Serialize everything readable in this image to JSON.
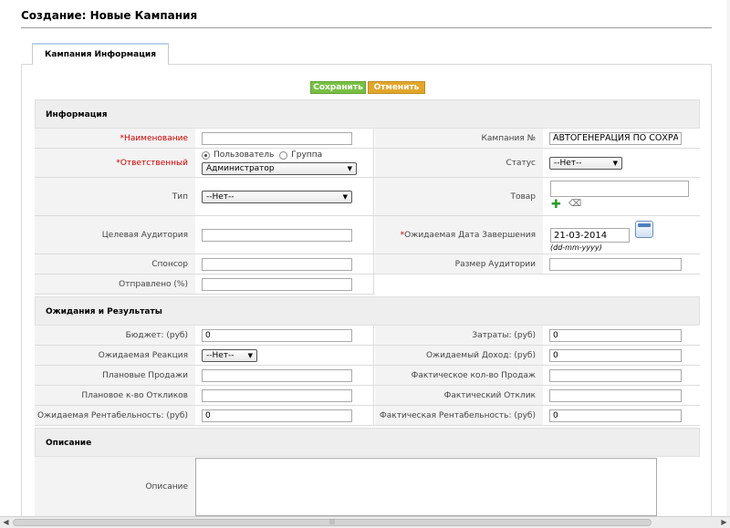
{
  "page": {
    "title": "Создание: Новые Кампания"
  },
  "tabs": [
    {
      "label": "Кампания Информация",
      "active": true
    }
  ],
  "toolbar": {
    "save_label": "Сохранить",
    "cancel_label": "Отменить"
  },
  "sections": {
    "info": "Информация",
    "expectations": "Ожидания и Результаты",
    "description": "Описание"
  },
  "info": {
    "name_label": "*Наименование",
    "name_value": "",
    "campaign_no_label": "Кампания №",
    "campaign_no_value": "АВТОГЕНЕРАЦИЯ ПО СОХРА",
    "owner_label": "*Ответственный",
    "owner_radio_user": "Пользователь",
    "owner_radio_group": "Группа",
    "owner_select": "Администратор",
    "status_label": "Статус",
    "status_select": "--Нет--",
    "type_label": "Тип",
    "type_select": "--Нет--",
    "product_label": "Товар",
    "product_value": "",
    "audience_label": "Целевая Аудитория",
    "audience_value": "",
    "expected_close_label": "*Ожидаемая Дата Завершения",
    "expected_close_value": "21-03-2014",
    "date_format_hint": "(dd-mm-yyyy)",
    "sponsor_label": "Спонсор",
    "sponsor_value": "",
    "audience_size_label": "Размер Аудитории",
    "audience_size_value": "",
    "sent_label": "Отправлено (%)",
    "sent_value": ""
  },
  "expectations": {
    "budget_label": "Бюджет: (руб)",
    "budget_value": "0",
    "cost_label": "Затраты: (руб)",
    "cost_value": "0",
    "expected_response_label": "Ожидаемая Реакция",
    "expected_response_select": "--Нет--",
    "expected_revenue_label": "Ожидаемый Доход: (руб)",
    "expected_revenue_value": "0",
    "planned_sales_label": "Плановые Продажи",
    "planned_sales_value": "",
    "actual_sales_label": "Фактическое кол-во Продаж",
    "actual_sales_value": "",
    "planned_responses_label": "Плановое к-во Откликов",
    "planned_responses_value": "",
    "actual_response_label": "Фактический Отклик",
    "actual_response_value": "",
    "expected_roi_label": "Ожидаемая Рентабельность: (руб)",
    "expected_roi_value": "0",
    "actual_roi_label": "Фактическая Рентабельность: (руб)",
    "actual_roi_value": "0"
  },
  "description": {
    "label": "Описание",
    "value": ""
  },
  "icons": {
    "calendar": "calendar-icon",
    "add": "plus-icon",
    "clear": "eraser-icon"
  },
  "colors": {
    "save": "#77c043",
    "cancel": "#e1a62b",
    "required": "#cc0000"
  }
}
